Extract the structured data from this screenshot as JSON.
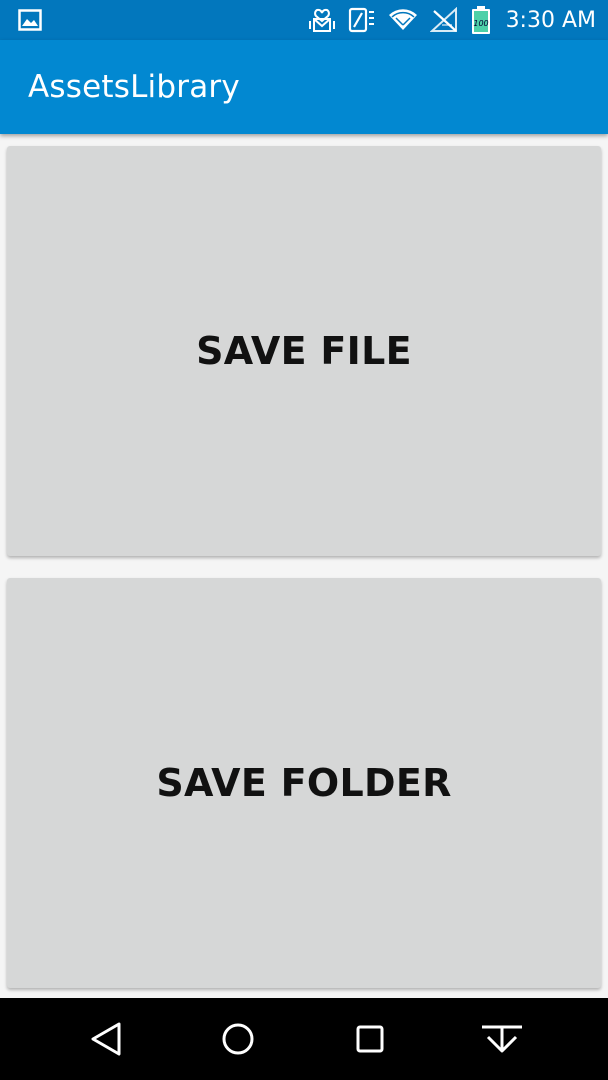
{
  "status_bar": {
    "time": "3:30 AM",
    "battery_level": "100",
    "icons": [
      "image-icon",
      "message-icon",
      "sim-icon",
      "wifi-icon",
      "no-signal-icon",
      "battery-icon"
    ]
  },
  "app_bar": {
    "title": "AssetsLibrary"
  },
  "buttons": {
    "save_file_label": "SAVE FILE",
    "save_folder_label": "SAVE FOLDER"
  },
  "nav_bar": {
    "icons": [
      "back-icon",
      "home-icon",
      "recents-icon",
      "notifications-down-icon"
    ]
  },
  "colors": {
    "status_bar": "#0277bd",
    "app_bar": "#0288d1",
    "button_bg": "#d6d7d7",
    "background": "#f5f5f5"
  }
}
